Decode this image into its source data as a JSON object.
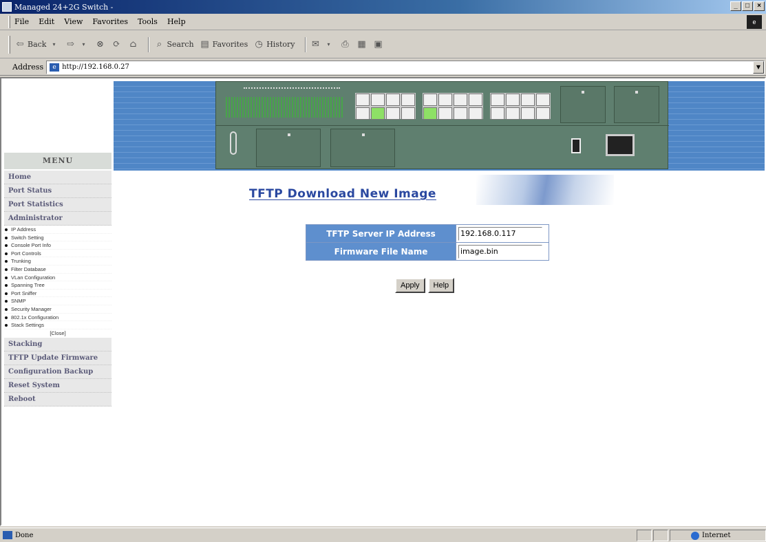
{
  "window": {
    "title": "Managed 24+2G Switch -"
  },
  "menubar": {
    "items": [
      "File",
      "Edit",
      "View",
      "Favorites",
      "Tools",
      "Help"
    ]
  },
  "toolbar": {
    "back": "Back",
    "search": "Search",
    "favorites": "Favorites",
    "history": "History"
  },
  "address": {
    "label": "Address",
    "url": "http://192.168.0.27"
  },
  "menu": {
    "header": "MENU",
    "top_items": [
      "Home",
      "Port Status",
      "Port Statistics",
      "Administrator"
    ],
    "sub_items": [
      "IP Address",
      "Switch Setting",
      "Console Port Info",
      "Port Controls",
      "Trunking",
      "Filter Database",
      "VLan Configuration",
      "Spanning Tree",
      "Port Sniffer",
      "SNMP",
      "Security Manager",
      "802.1x Configuration",
      "Stack Settings"
    ],
    "close": "[Close]",
    "bottom_items": [
      "Stacking",
      "TFTP Update Firmware",
      "Configuration Backup",
      "Reset System",
      "Reboot"
    ]
  },
  "page": {
    "title": "TFTP Download New Image"
  },
  "form": {
    "server_ip_label": "TFTP Server IP Address",
    "server_ip_value": "192.168.0.117",
    "file_name_label": "Firmware File Name",
    "file_name_value": "image.bin"
  },
  "buttons": {
    "apply": "Apply",
    "help": "Help"
  },
  "status": {
    "text": "Done",
    "zone": "Internet"
  }
}
